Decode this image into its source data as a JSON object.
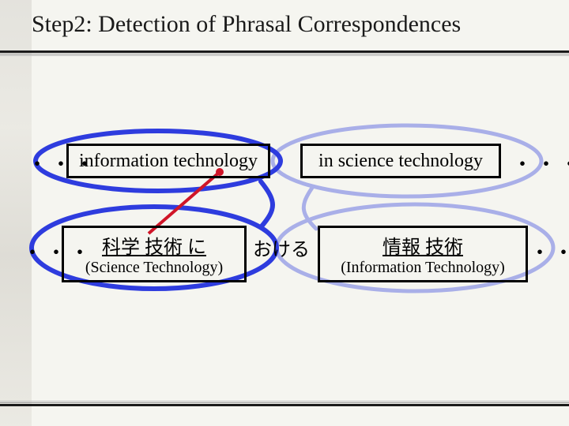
{
  "title": "Step2: Detection of Phrasal Correspondences",
  "row_en": {
    "leading_ellipsis": "・・・",
    "box1": "information technology",
    "box2": "in science technology",
    "trailing_ellipsis": "・・・"
  },
  "row_jp": {
    "leading_ellipsis": "・・・",
    "box1_main": "科学  技術  に",
    "box1_sub": "(Science Technology)",
    "connector": "おける",
    "box2_main": "情報  技術",
    "box2_sub": "(Information Technology)",
    "trailing_ellipsis": "・・・"
  },
  "colors": {
    "link_blue": "#2e3cde",
    "link_blue_light": "#a9afe8",
    "link_red": "#d01528"
  }
}
